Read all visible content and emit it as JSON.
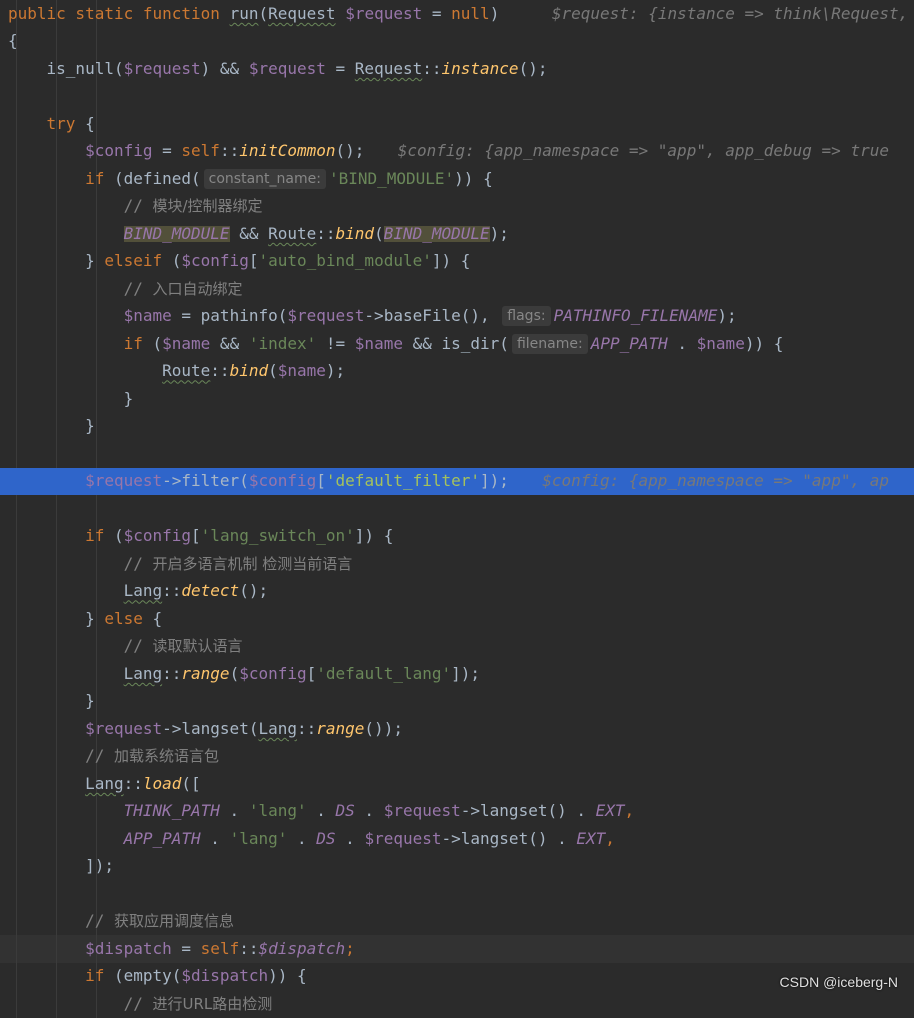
{
  "editor": {
    "lines": [
      {
        "tokens": [
          [
            "kw",
            "public static function "
          ],
          [
            "fn-u",
            "run"
          ],
          [
            "p",
            "("
          ],
          [
            "cls",
            "Request"
          ],
          [
            "p",
            " "
          ],
          [
            "var",
            "$request"
          ],
          [
            "p",
            " = "
          ],
          [
            "kw",
            "null"
          ],
          [
            "p",
            ")  "
          ],
          [
            "hint",
            "  $request: {instance => think\\Request,"
          ]
        ]
      },
      {
        "tokens": [
          [
            "p",
            "{"
          ]
        ]
      },
      {
        "tokens": [
          [
            "p",
            "    is_null("
          ],
          [
            "var",
            "$request"
          ],
          [
            "p",
            ") && "
          ],
          [
            "var",
            "$request"
          ],
          [
            "p",
            " = "
          ],
          [
            "cls",
            "Request"
          ],
          [
            "p",
            "::"
          ],
          [
            "static",
            "instance"
          ],
          [
            "p",
            "();"
          ]
        ]
      },
      {
        "tokens": []
      },
      {
        "tokens": [
          [
            "kw",
            "    try"
          ],
          [
            "p",
            " {"
          ]
        ]
      },
      {
        "tokens": [
          [
            "var",
            "        $config"
          ],
          [
            "p",
            " = "
          ],
          [
            "kw",
            "self"
          ],
          [
            "p",
            "::"
          ],
          [
            "static",
            "initCommon"
          ],
          [
            "p",
            "();"
          ],
          [
            "hint",
            "  $config: {app_namespace => \"app\", app_debug => true"
          ]
        ]
      },
      {
        "tokens": [
          [
            "kw",
            "        if"
          ],
          [
            "p",
            " (defined("
          ],
          [
            "ph",
            "constant_name:"
          ],
          [
            "str",
            "'BIND_MODULE'"
          ],
          [
            "p",
            ")) {"
          ]
        ]
      },
      {
        "tokens": [
          [
            "cmt",
            "            // "
          ],
          [
            "cmtcn",
            "模块/控制器绑定"
          ]
        ]
      },
      {
        "tokens": [
          [
            "p",
            "            "
          ],
          [
            "consth",
            "BIND_MODULE"
          ],
          [
            "p",
            " && "
          ],
          [
            "cls",
            "Route"
          ],
          [
            "p",
            "::"
          ],
          [
            "static",
            "bind"
          ],
          [
            "p",
            "("
          ],
          [
            "consth",
            "BIND_MODULE"
          ],
          [
            "p",
            ");"
          ]
        ]
      },
      {
        "tokens": [
          [
            "p",
            "        } "
          ],
          [
            "kw",
            "elseif"
          ],
          [
            "p",
            " ("
          ],
          [
            "var",
            "$config"
          ],
          [
            "p",
            "["
          ],
          [
            "str",
            "'auto_bind_module'"
          ],
          [
            "p",
            "]) {"
          ]
        ]
      },
      {
        "tokens": [
          [
            "cmt",
            "            // "
          ],
          [
            "cmtcn",
            "入口自动绑定"
          ]
        ]
      },
      {
        "tokens": [
          [
            "var",
            "            $name"
          ],
          [
            "p",
            " = pathinfo("
          ],
          [
            "var",
            "$request"
          ],
          [
            "p",
            "->baseFile(), "
          ],
          [
            "ph",
            "flags:"
          ],
          [
            "const",
            "PATHINFO_FILENAME"
          ],
          [
            "p",
            ");"
          ]
        ]
      },
      {
        "tokens": [
          [
            "kw",
            "            if"
          ],
          [
            "p",
            " ("
          ],
          [
            "var",
            "$name"
          ],
          [
            "p",
            " && "
          ],
          [
            "str",
            "'index'"
          ],
          [
            "p",
            " != "
          ],
          [
            "var",
            "$name"
          ],
          [
            "p",
            " && is_dir("
          ],
          [
            "ph",
            "filename:"
          ],
          [
            "const",
            "APP_PATH"
          ],
          [
            "p",
            " . "
          ],
          [
            "var",
            "$name"
          ],
          [
            "p",
            ")) {"
          ]
        ]
      },
      {
        "tokens": [
          [
            "p",
            "                "
          ],
          [
            "cls",
            "Route"
          ],
          [
            "p",
            "::"
          ],
          [
            "static",
            "bind"
          ],
          [
            "p",
            "("
          ],
          [
            "var",
            "$name"
          ],
          [
            "p",
            ");"
          ]
        ]
      },
      {
        "tokens": [
          [
            "p",
            "            }"
          ]
        ]
      },
      {
        "tokens": [
          [
            "p",
            "        }"
          ]
        ]
      },
      {
        "tokens": []
      },
      {
        "tokens": [
          [
            "var",
            "        $request"
          ],
          [
            "p",
            "->filter("
          ],
          [
            "var",
            "$config"
          ],
          [
            "p",
            "["
          ],
          [
            "str",
            "'default_filter'"
          ],
          [
            "p",
            "]);"
          ],
          [
            "hint",
            "  $config: {app_namespace => \"app\", ap"
          ]
        ],
        "selected": true
      },
      {
        "tokens": []
      },
      {
        "tokens": [
          [
            "kw",
            "        if"
          ],
          [
            "p",
            " ("
          ],
          [
            "var",
            "$config"
          ],
          [
            "p",
            "["
          ],
          [
            "str",
            "'lang_switch_on'"
          ],
          [
            "p",
            "]) {"
          ]
        ]
      },
      {
        "tokens": [
          [
            "cmt",
            "            // "
          ],
          [
            "cmtcn",
            "开启多语言机制 检测当前语言"
          ]
        ]
      },
      {
        "tokens": [
          [
            "p",
            "            "
          ],
          [
            "cls",
            "Lang"
          ],
          [
            "p",
            "::"
          ],
          [
            "static",
            "detect"
          ],
          [
            "p",
            "();"
          ]
        ]
      },
      {
        "tokens": [
          [
            "p",
            "        } "
          ],
          [
            "kw",
            "else"
          ],
          [
            "p",
            " {"
          ]
        ]
      },
      {
        "tokens": [
          [
            "cmt",
            "            // "
          ],
          [
            "cmtcn",
            "读取默认语言"
          ]
        ]
      },
      {
        "tokens": [
          [
            "p",
            "            "
          ],
          [
            "cls",
            "Lang"
          ],
          [
            "p",
            "::"
          ],
          [
            "static",
            "range"
          ],
          [
            "p",
            "("
          ],
          [
            "var",
            "$config"
          ],
          [
            "p",
            "["
          ],
          [
            "str",
            "'default_lang'"
          ],
          [
            "p",
            "]);"
          ]
        ]
      },
      {
        "tokens": [
          [
            "p",
            "        }"
          ]
        ]
      },
      {
        "tokens": [
          [
            "var",
            "        $request"
          ],
          [
            "p",
            "->langset("
          ],
          [
            "cls",
            "Lang"
          ],
          [
            "p",
            "::"
          ],
          [
            "static",
            "range"
          ],
          [
            "p",
            "());"
          ]
        ]
      },
      {
        "tokens": [
          [
            "cmt",
            "        // "
          ],
          [
            "cmtcn",
            "加载系统语言包"
          ]
        ]
      },
      {
        "tokens": [
          [
            "p",
            "        "
          ],
          [
            "cls",
            "Lang"
          ],
          [
            "p",
            "::"
          ],
          [
            "static",
            "load"
          ],
          [
            "p",
            "(["
          ]
        ]
      },
      {
        "tokens": [
          [
            "p",
            "            "
          ],
          [
            "const",
            "THINK_PATH"
          ],
          [
            "p",
            " . "
          ],
          [
            "str",
            "'lang'"
          ],
          [
            "p",
            " . "
          ],
          [
            "const",
            "DS"
          ],
          [
            "p",
            " . "
          ],
          [
            "var",
            "$request"
          ],
          [
            "p",
            "->langset() . "
          ],
          [
            "const",
            "EXT"
          ],
          [
            "kw",
            ","
          ]
        ]
      },
      {
        "tokens": [
          [
            "p",
            "            "
          ],
          [
            "const",
            "APP_PATH"
          ],
          [
            "p",
            " . "
          ],
          [
            "str",
            "'lang'"
          ],
          [
            "p",
            " . "
          ],
          [
            "const",
            "DS"
          ],
          [
            "p",
            " . "
          ],
          [
            "var",
            "$request"
          ],
          [
            "p",
            "->langset() . "
          ],
          [
            "const",
            "EXT"
          ],
          [
            "kw",
            ","
          ]
        ]
      },
      {
        "tokens": [
          [
            "p",
            "        ]);"
          ]
        ]
      },
      {
        "tokens": []
      },
      {
        "tokens": [
          [
            "cmt",
            "        // "
          ],
          [
            "cmtcn",
            "获取应用调度信息"
          ]
        ]
      },
      {
        "tokens": [
          [
            "var",
            "        $dispatch"
          ],
          [
            "p",
            " = "
          ],
          [
            "kw",
            "self"
          ],
          [
            "p",
            "::"
          ],
          [
            "constv",
            "$dispatch"
          ],
          [
            "kw",
            ";"
          ]
        ],
        "current": true
      },
      {
        "tokens": [
          [
            "kw",
            "        if"
          ],
          [
            "p",
            " (empty("
          ],
          [
            "var",
            "$dispatch"
          ],
          [
            "p",
            ")) {"
          ]
        ]
      },
      {
        "tokens": [
          [
            "cmt",
            "            // "
          ],
          [
            "cmtcn",
            "进行URL路由检测"
          ]
        ]
      }
    ]
  },
  "watermark": "CSDN @iceberg-N"
}
